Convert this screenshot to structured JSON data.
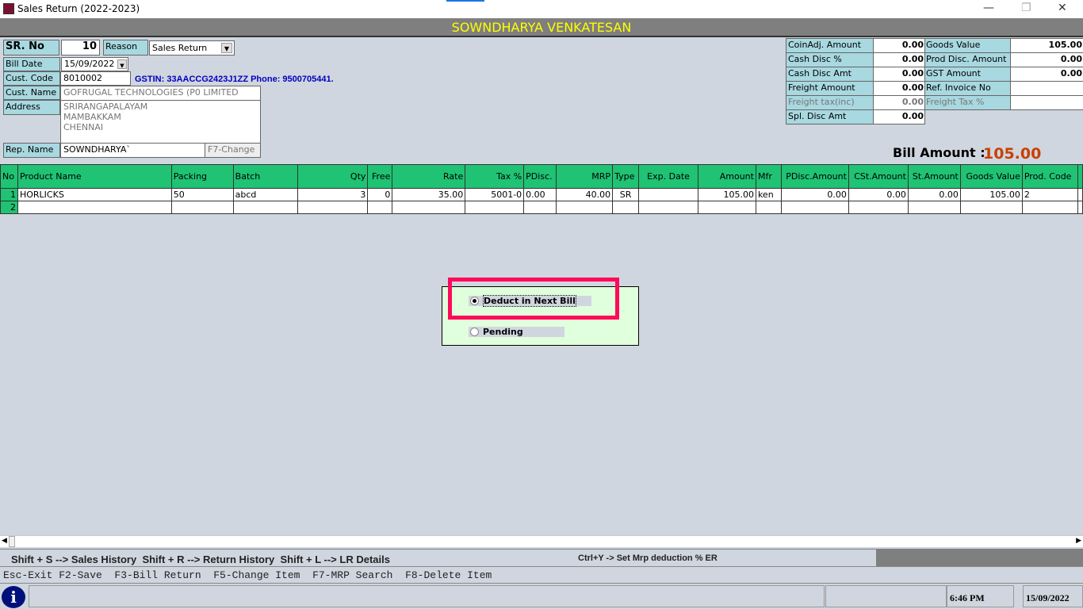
{
  "window": {
    "title": "Sales Return (2022-2023)",
    "minimize": "—",
    "restore": "❐",
    "close": "✕"
  },
  "header": {
    "user": "SOWNDHARYA VENKATESAN"
  },
  "form": {
    "sr_no_label": "SR. No",
    "sr_no": "10",
    "reason_label": "Reason",
    "reason": "Sales Return",
    "bill_date_label": "Bill Date",
    "bill_date": "15/09/2022",
    "cust_code_label": "Cust. Code",
    "cust_code": "8010002",
    "gstin_phone": "GSTIN: 33AACCG2423J1ZZ Phone: 9500705441.",
    "cust_name_label": "Cust. Name",
    "cust_name": "GOFRUGAL TECHNOLOGIES (P0 LIMITED",
    "address_label": "Address",
    "address": [
      "SRIRANGAPALAYAM",
      "MAMBAKKAM",
      "CHENNAI"
    ],
    "rep_name_label": "Rep. Name",
    "rep_name": "SOWNDHARYA`",
    "f7_change": "F7-Change"
  },
  "summary_left": [
    {
      "label": "CoinAdj. Amount",
      "value": "0.00"
    },
    {
      "label": "Cash Disc %",
      "value": "0.00"
    },
    {
      "label": "Cash Disc Amt",
      "value": "0.00"
    },
    {
      "label": "Freight Amount",
      "value": "0.00"
    },
    {
      "label": "Freight tax(inc)",
      "value": "0.00",
      "disabled": true
    },
    {
      "label": "Spl. Disc Amt",
      "value": "0.00"
    }
  ],
  "summary_right": [
    {
      "label": "Goods Value",
      "value": "105.00"
    },
    {
      "label": "Prod Disc. Amount",
      "value": "0.00"
    },
    {
      "label": "GST Amount",
      "value": "0.00"
    },
    {
      "label": "Ref. Invoice No",
      "value": ""
    },
    {
      "label": "Freight Tax %",
      "value": "",
      "disabled": true
    }
  ],
  "bill_amount": {
    "label": "Bill Amount :",
    "value": "105.00"
  },
  "grid": {
    "columns": [
      "No",
      "Product Name",
      "Packing",
      "Batch",
      "Qty",
      "Free",
      "Rate",
      "Tax %",
      "PDisc.",
      "MRP",
      "Type",
      "Exp. Date",
      "Amount",
      "Mfr",
      "PDisc.Amount",
      "CSt.Amount",
      "St.Amount",
      "Goods Value",
      "Prod. Code"
    ],
    "rows": [
      [
        "1",
        "HORLICKS",
        "50",
        "abcd",
        "3",
        "0",
        "35.00",
        "5001-0",
        "0.00",
        "40.00",
        "SR",
        "",
        "105.00",
        "ken",
        "0.00",
        "0.00",
        "0.00",
        "105.00",
        "2"
      ],
      [
        "2",
        "",
        "",
        "",
        "",
        "",
        "",
        "",
        "",
        "",
        "",
        "",
        "",
        "",
        "",
        "",
        "",
        "",
        ""
      ]
    ]
  },
  "dialog": {
    "options": [
      {
        "label": "Deduct in Next Bill",
        "selected": true
      },
      {
        "label": "Pending",
        "selected": false
      }
    ]
  },
  "shortcuts": {
    "line1": "Shift + S --> Sales History  Shift + R --> Return History  Shift + L --> LR Details",
    "line1_right": "Ctrl+Y -> Set Mrp deduction % ER",
    "line2": "Esc-Exit F2-Save  F3-Bill Return  F5-Change Item  F7-MRP Search  F8-Delete Item"
  },
  "statusbar": {
    "time": "6:46 PM",
    "date": "15/09/2022"
  },
  "colors": {
    "header_bg": "#7f7f7f",
    "header_text": "#ffff00",
    "grid_header": "#1fc373",
    "label_bg": "#a8d8e0",
    "highlight": "#ff0a5a",
    "bill_amount": "#c84000"
  }
}
